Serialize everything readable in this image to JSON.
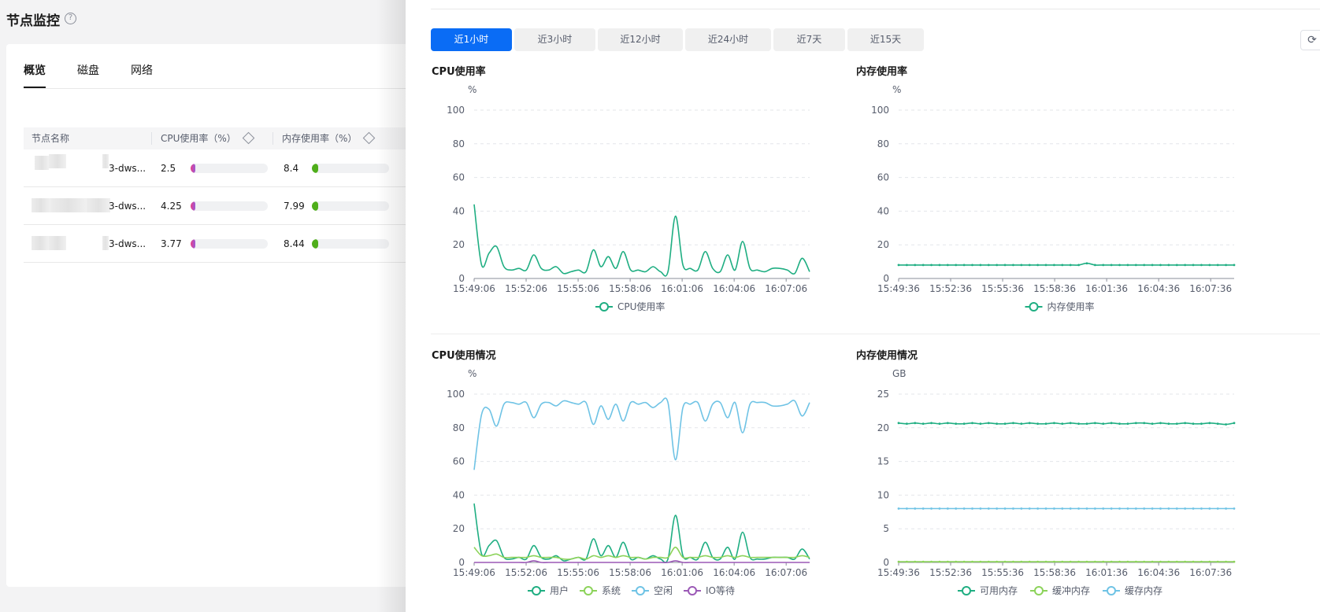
{
  "page": {
    "title": "节点监控",
    "help_icon": "?"
  },
  "tabs": [
    {
      "label": "概览"
    },
    {
      "label": "磁盘"
    },
    {
      "label": "网络"
    }
  ],
  "table": {
    "headers": {
      "name": "节点名称",
      "cpu": "CPU使用率（%）",
      "mem": "内存使用率（%）"
    },
    "rows": [
      {
        "name_suffix": "3-dws...",
        "cpu": "2.5",
        "cpu_value": 2.5,
        "mem": "8.4",
        "mem_value": 8.4
      },
      {
        "name_suffix": "3-dws...",
        "cpu": "4.25",
        "cpu_value": 4.25,
        "mem": "7.99",
        "mem_value": 7.99
      },
      {
        "name_suffix": "3-dws...",
        "cpu": "3.77",
        "cpu_value": 3.77,
        "mem": "8.44",
        "mem_value": 8.44
      }
    ]
  },
  "time_ranges": [
    {
      "label": "近1小时",
      "active": true
    },
    {
      "label": "近3小时"
    },
    {
      "label": "近12小时"
    },
    {
      "label": "近24小时"
    },
    {
      "label": "近7天"
    },
    {
      "label": "近15天"
    }
  ],
  "refresh_icon": "refresh-icon",
  "colors": {
    "primary": "#0a6cf5",
    "green": "#1fae82",
    "lightgreen": "#8cd35a",
    "blue": "#6fc3e5",
    "purple": "#9b59b6",
    "pink": "#e8408a",
    "bar_green": "#4fae1b"
  },
  "chart_data": [
    {
      "type": "line",
      "title": "CPU使用率",
      "ylabel": "%",
      "ylim": [
        0,
        100
      ],
      "yticks": [
        0,
        20,
        40,
        60,
        80,
        100
      ],
      "xticks": [
        "15:49:06",
        "15:52:06",
        "15:55:06",
        "15:58:06",
        "16:01:06",
        "16:04:06",
        "16:07:06"
      ],
      "series": [
        {
          "name": "CPU使用率",
          "color": "#1fae82",
          "values": [
            44,
            8,
            15,
            19,
            7,
            5,
            6,
            5,
            14,
            6,
            5,
            7,
            3,
            4,
            5,
            4,
            17,
            7,
            13,
            6,
            16,
            5,
            5,
            4,
            7,
            4,
            4,
            37,
            8,
            6,
            5,
            16,
            6,
            4,
            14,
            5,
            22,
            6,
            5,
            4,
            6,
            6,
            5,
            3,
            12,
            4
          ]
        }
      ],
      "legend": "bottom"
    },
    {
      "type": "line",
      "title": "内存使用率",
      "ylabel": "%",
      "ylim": [
        0,
        100
      ],
      "yticks": [
        0,
        20,
        40,
        60,
        80,
        100
      ],
      "xticks": [
        "15:49:36",
        "15:52:36",
        "15:55:36",
        "15:58:36",
        "16:01:36",
        "16:04:36",
        "16:07:36"
      ],
      "markers": true,
      "series": [
        {
          "name": "内存使用率",
          "color": "#1fae82",
          "values": [
            8,
            8,
            8,
            8,
            8,
            8,
            8,
            8,
            8,
            8,
            8,
            8,
            8,
            8,
            8,
            8,
            8,
            8,
            8,
            8,
            8,
            8,
            8,
            9,
            8,
            8,
            8,
            8,
            8,
            8,
            8,
            8,
            8,
            8,
            8,
            8,
            8,
            8,
            8,
            8,
            8,
            8
          ]
        }
      ],
      "legend": "bottom"
    },
    {
      "type": "line",
      "title": "CPU使用情况",
      "ylabel": "%",
      "ylim": [
        0,
        100
      ],
      "yticks": [
        0,
        20,
        40,
        60,
        80,
        100
      ],
      "xticks": [
        "15:49:06",
        "15:52:06",
        "15:55:06",
        "15:58:06",
        "16:01:06",
        "16:04:06",
        "16:07:06"
      ],
      "series": [
        {
          "name": "用户",
          "color": "#1fae82",
          "values": [
            35,
            5,
            10,
            13,
            3,
            2,
            3,
            2,
            10,
            3,
            2,
            4,
            1,
            2,
            3,
            2,
            14,
            4,
            10,
            3,
            12,
            2,
            3,
            2,
            4,
            2,
            2,
            28,
            4,
            3,
            2,
            12,
            3,
            2,
            9,
            2,
            18,
            3,
            2,
            2,
            3,
            3,
            3,
            2,
            8,
            2
          ]
        },
        {
          "name": "系统",
          "color": "#8cd35a",
          "values": [
            9,
            4,
            4,
            5,
            3,
            3,
            3,
            3,
            4,
            3,
            3,
            3,
            2,
            2,
            3,
            2,
            4,
            3,
            4,
            3,
            4,
            3,
            3,
            2,
            3,
            3,
            3,
            9,
            3,
            3,
            3,
            4,
            3,
            3,
            4,
            3,
            4,
            3,
            3,
            3,
            3,
            3,
            3,
            3,
            4,
            3
          ]
        },
        {
          "name": "空闲",
          "color": "#6fc3e5",
          "values": [
            55,
            88,
            91,
            81,
            94,
            95,
            94,
            95,
            86,
            94,
            95,
            93,
            96,
            95,
            94,
            95,
            82,
            93,
            85,
            94,
            84,
            95,
            94,
            95,
            92,
            95,
            95,
            61,
            92,
            94,
            95,
            84,
            94,
            95,
            86,
            95,
            77,
            94,
            95,
            95,
            93,
            93,
            94,
            96,
            87,
            95
          ]
        },
        {
          "name": "IO等待",
          "color": "#9b59b6",
          "values": [
            0,
            0,
            0,
            0,
            0,
            0,
            0,
            0,
            1,
            0,
            0,
            0,
            0,
            0,
            0,
            0,
            0,
            0,
            0,
            0,
            0,
            0,
            0,
            0,
            0,
            0,
            0,
            1,
            0,
            0,
            0,
            0,
            0,
            0,
            0,
            0,
            0,
            0,
            0,
            0,
            0,
            0,
            0,
            0,
            0,
            0
          ]
        }
      ],
      "legend": "bottom"
    },
    {
      "type": "line",
      "title": "内存使用情况",
      "ylabel": "GB",
      "ylim": [
        0,
        25
      ],
      "yticks": [
        0,
        5,
        10,
        15,
        20,
        25
      ],
      "xticks": [
        "15:49:36",
        "15:52:36",
        "15:55:36",
        "15:58:36",
        "16:01:36",
        "16:04:36",
        "16:07:36"
      ],
      "markers": true,
      "series": [
        {
          "name": "可用内存",
          "color": "#1fae82",
          "values": [
            20.7,
            20.6,
            20.7,
            20.6,
            20.7,
            20.6,
            20.7,
            20.6,
            20.6,
            20.7,
            20.6,
            20.7,
            20.6,
            20.6,
            20.7,
            20.6,
            20.7,
            20.6,
            20.6,
            20.7,
            20.6,
            20.7,
            20.6,
            20.6,
            20.7,
            20.6,
            20.7,
            20.6,
            20.6,
            20.7,
            20.7,
            20.6,
            20.7,
            20.6,
            20.6,
            20.7,
            20.6,
            20.6,
            20.7,
            20.6,
            20.5,
            20.7
          ]
        },
        {
          "name": "缓冲内存",
          "color": "#8cd35a",
          "values": [
            0.1,
            0.1,
            0.1,
            0.1,
            0.1,
            0.1,
            0.1,
            0.1,
            0.1,
            0.1,
            0.1,
            0.1,
            0.1,
            0.1,
            0.1,
            0.1,
            0.1,
            0.1,
            0.1,
            0.1,
            0.1,
            0.1,
            0.1,
            0.1,
            0.1,
            0.1,
            0.1,
            0.1,
            0.1,
            0.1,
            0.1,
            0.1,
            0.1,
            0.1,
            0.1,
            0.1,
            0.1,
            0.1,
            0.1,
            0.1,
            0.1,
            0.1
          ]
        },
        {
          "name": "缓存内存",
          "color": "#6fc3e5",
          "values": [
            8,
            8,
            8,
            8,
            8,
            8,
            8,
            8,
            8,
            8,
            8,
            8,
            8,
            8,
            8,
            8,
            8,
            8,
            8,
            8,
            8,
            8,
            8,
            8,
            8,
            8,
            8,
            8,
            8,
            8,
            8,
            8,
            8,
            8,
            8,
            8,
            8,
            8,
            8,
            8,
            8,
            8
          ]
        }
      ],
      "legend": "bottom"
    }
  ]
}
